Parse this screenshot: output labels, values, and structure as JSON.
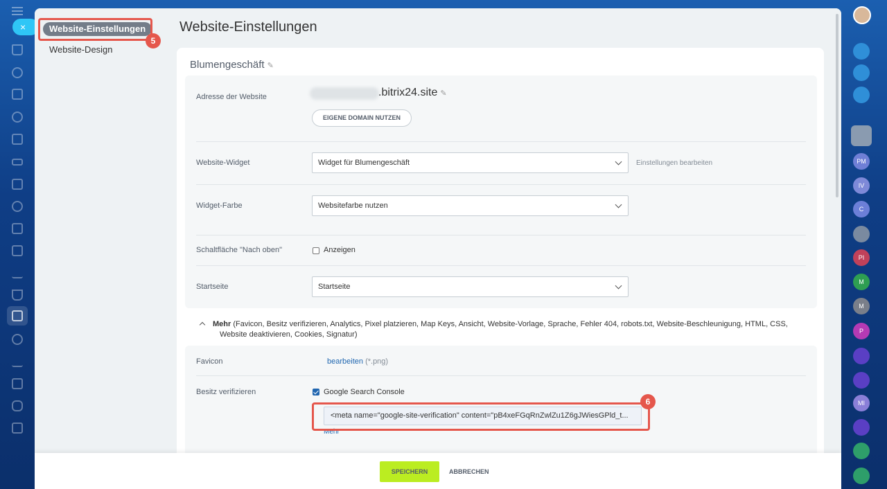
{
  "left_rail": {
    "close_glyph": "×",
    "icons": [
      "home-icon",
      "tasks-icon",
      "feed-icon",
      "contacts-icon",
      "documents-icon",
      "drive-icon",
      "projects-icon",
      "chat-icon",
      "calendar-icon",
      "check-icon",
      "analytics-icon",
      "filter-icon",
      "shop-icon",
      "automation-icon",
      "sign-icon",
      "employees-icon",
      "database-icon",
      "more-icon"
    ]
  },
  "sidebar": {
    "items": [
      {
        "label": "Website-Einstellungen",
        "active": true
      },
      {
        "label": "Website-Design",
        "active": false
      }
    ]
  },
  "main": {
    "title": "Website-Einstellungen",
    "site_name": "Blumengeschäft",
    "pencil_glyph": "✎"
  },
  "address": {
    "label": "Adresse der Website",
    "domain_suffix": ".bitrix24.site",
    "button": "EIGENE DOMAIN NUTZEN"
  },
  "widget": {
    "label": "Website-Widget",
    "value": "Widget für Blumengeschäft",
    "hint": "Einstellungen bearbeiten"
  },
  "widget_color": {
    "label": "Widget-Farbe",
    "value": "Websitefarbe nutzen"
  },
  "top_button": {
    "label": "Schaltfläche \"Nach oben\"",
    "checkbox_label": "Anzeigen",
    "checked": false
  },
  "start_page": {
    "label": "Startseite",
    "value": "Startseite"
  },
  "more": {
    "title": "Mehr",
    "items": "(Favicon, Besitz verifizieren, Analytics, Pixel platzieren, Map Keys, Ansicht, Website-Vorlage, Sprache, Fehler 404, robots.txt, Website-Beschleunigung, HTML, CSS, Website deaktivieren, Cookies, Signatur)"
  },
  "favicon": {
    "label": "Favicon",
    "link": "bearbeiten",
    "hint": "(*.png)"
  },
  "verify": {
    "label": "Besitz verifizieren",
    "checkbox_label": "Google Search Console",
    "checked": true,
    "meta_value": "<meta name=\"google-site-verification\" content=\"pB4xeFGqRnZwlZu1Z6gJWiesGPld_t...",
    "more_link": "Mehr"
  },
  "annotations": {
    "badge_1": "5",
    "badge_2": "6"
  },
  "footer": {
    "save": "SPEICHERN",
    "cancel": "ABBRECHEN"
  },
  "right_rail": {
    "items": [
      {
        "text": "",
        "color": "#2f8fd8",
        "name": "notifications-icon"
      },
      {
        "text": "",
        "color": "#2f8fd8",
        "name": "copilot-icon"
      },
      {
        "text": "",
        "color": "#2f8fd8",
        "name": "search-chat-icon"
      },
      {
        "text": "",
        "color": "#8a9bb0",
        "name": "user-avatar"
      },
      {
        "text": "PM",
        "color": "#6f7fd6"
      },
      {
        "text": "IV",
        "color": "#7e89d8"
      },
      {
        "text": "C",
        "color": "#6c7fd8"
      },
      {
        "text": "",
        "color": "#7a8aa0",
        "name": "group-avatar"
      },
      {
        "text": "PI",
        "color": "#c0415a"
      },
      {
        "text": "M",
        "color": "#2e9e52"
      },
      {
        "text": "M",
        "color": "#7a7f8a"
      },
      {
        "text": "P",
        "color": "#b43ab4"
      },
      {
        "text": "",
        "color": "#5a3fc4",
        "name": "copilot-chat-icon"
      },
      {
        "text": "",
        "color": "#5a3fc4",
        "name": "copilot-chat-icon"
      },
      {
        "text": "MI",
        "color": "#8a7fd8"
      },
      {
        "text": "",
        "color": "#5a3fc4",
        "name": "copilot-chat-icon"
      },
      {
        "text": "",
        "color": "#2e9e6a",
        "name": "tasks-chat-icon"
      },
      {
        "text": "",
        "color": "#2e9e6a",
        "name": "lock-icon"
      }
    ]
  },
  "colors": {
    "accent": "#2fc6f6",
    "highlight": "#e5574c",
    "save": "#bbed21",
    "link": "#2067b0"
  }
}
